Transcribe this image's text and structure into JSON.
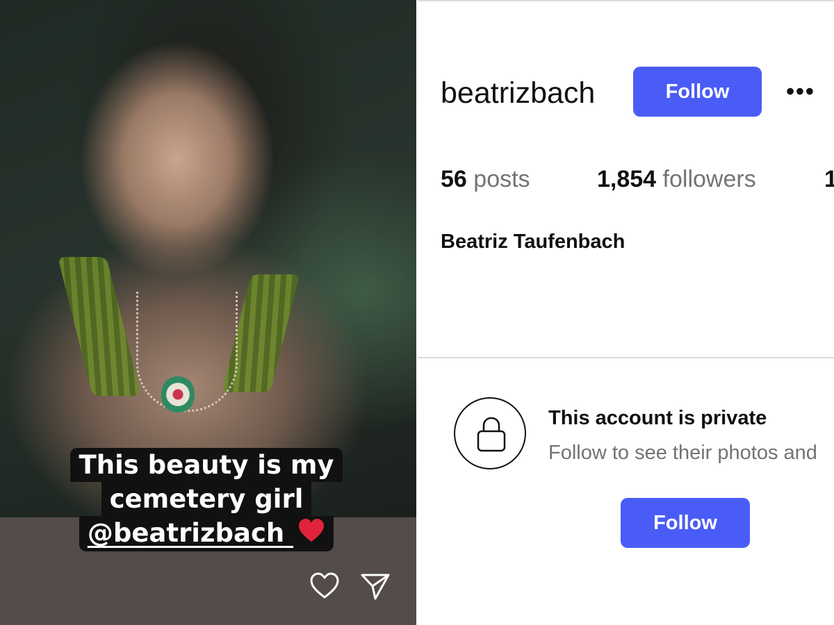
{
  "story": {
    "caption_lines": [
      "This beauty is my",
      "cemetery girl",
      "@beatrizbach"
    ],
    "mention_icon": "threads-logo-icon",
    "emoji": "red-heart-emoji",
    "actions": [
      {
        "name": "like",
        "icon": "heart-outline-icon"
      },
      {
        "name": "share",
        "icon": "paper-plane-icon"
      }
    ]
  },
  "profile": {
    "username": "beatrizbach",
    "follow_label": "Follow",
    "more_label": "•••",
    "stats": {
      "posts_count": "56",
      "posts_label": "posts",
      "followers_count": "1,854",
      "followers_label": "followers",
      "following_partial": "1"
    },
    "full_name": "Beatriz Taufenbach",
    "private": {
      "title": "This account is private",
      "subtitle": "Follow to see their photos and",
      "icon": "lock-icon",
      "follow_label": "Follow"
    }
  },
  "colors": {
    "accent": "#4a5cf6",
    "caption_bg": "#111111",
    "muted_text": "#737373",
    "heart": "#e0243b"
  }
}
